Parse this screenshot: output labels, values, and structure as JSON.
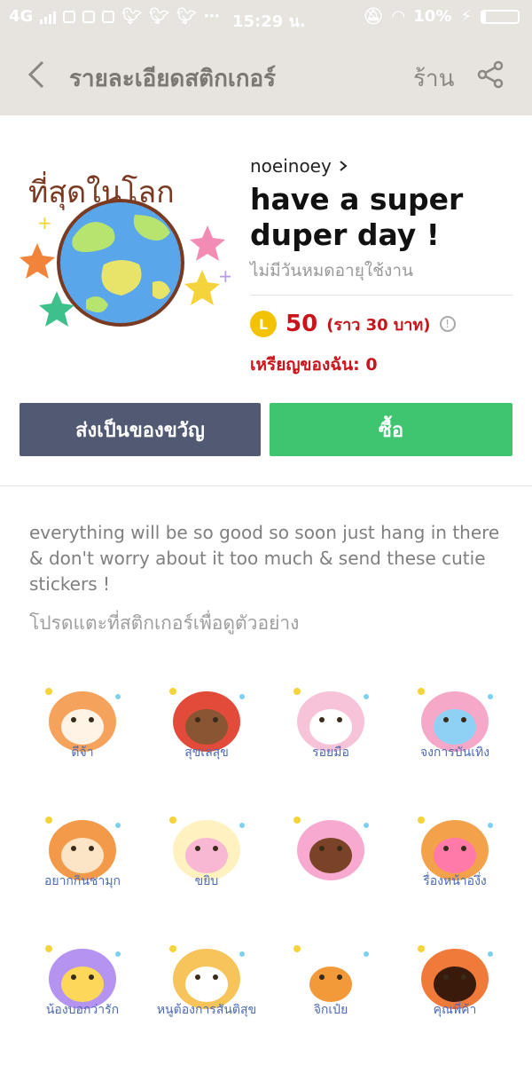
{
  "status_bar": {
    "network": "4G",
    "time": "15:29 น.",
    "battery": "10%"
  },
  "topbar": {
    "title": "รายละเอียดสติกเกอร์",
    "shop_label": "ร้าน"
  },
  "product": {
    "art_text": "ที่สุดในโลก",
    "author": "noeinoey",
    "name": "have a super duper day !",
    "validity": "ไม่มีวันหมดอายุใช้งาน",
    "coin_symbol": "L",
    "price": "50",
    "price_note": "(ราว 30 บาท)",
    "my_coins": "เหรียญของฉัน: 0"
  },
  "actions": {
    "gift_label": "ส่งเป็นของขวัญ",
    "buy_label": "ซื้อ"
  },
  "description": "everything will be so good so soon just hang in there & don't worry about it too much & send these cutie stickers !",
  "tap_hint": "โปรดแตะที่สติกเกอร์เพื่อดูตัวอย่าง",
  "stickers": [
    {
      "caption": "ดีจ้า"
    },
    {
      "caption": "สุขเลสุข"
    },
    {
      "caption": "รอยมือ"
    },
    {
      "caption": "จงการบันเทิง"
    },
    {
      "caption": "อยากกินชามุก"
    },
    {
      "caption": "ขยิบ"
    },
    {
      "caption": ""
    },
    {
      "caption": "รื่องหน้าองึ่ง"
    },
    {
      "caption": "น้องบอกว่ารัก"
    },
    {
      "caption": "หนูต้องการสันติสุข"
    },
    {
      "caption": "จิกเป๋ย"
    },
    {
      "caption": "คุณพี่ค้า"
    }
  ],
  "colors": {
    "topbar_bg": "#e7e3de",
    "gift_button": "#525a73",
    "buy_button": "#3fc46f",
    "price_red": "#c8151b",
    "coin_yellow": "#f3c200"
  }
}
